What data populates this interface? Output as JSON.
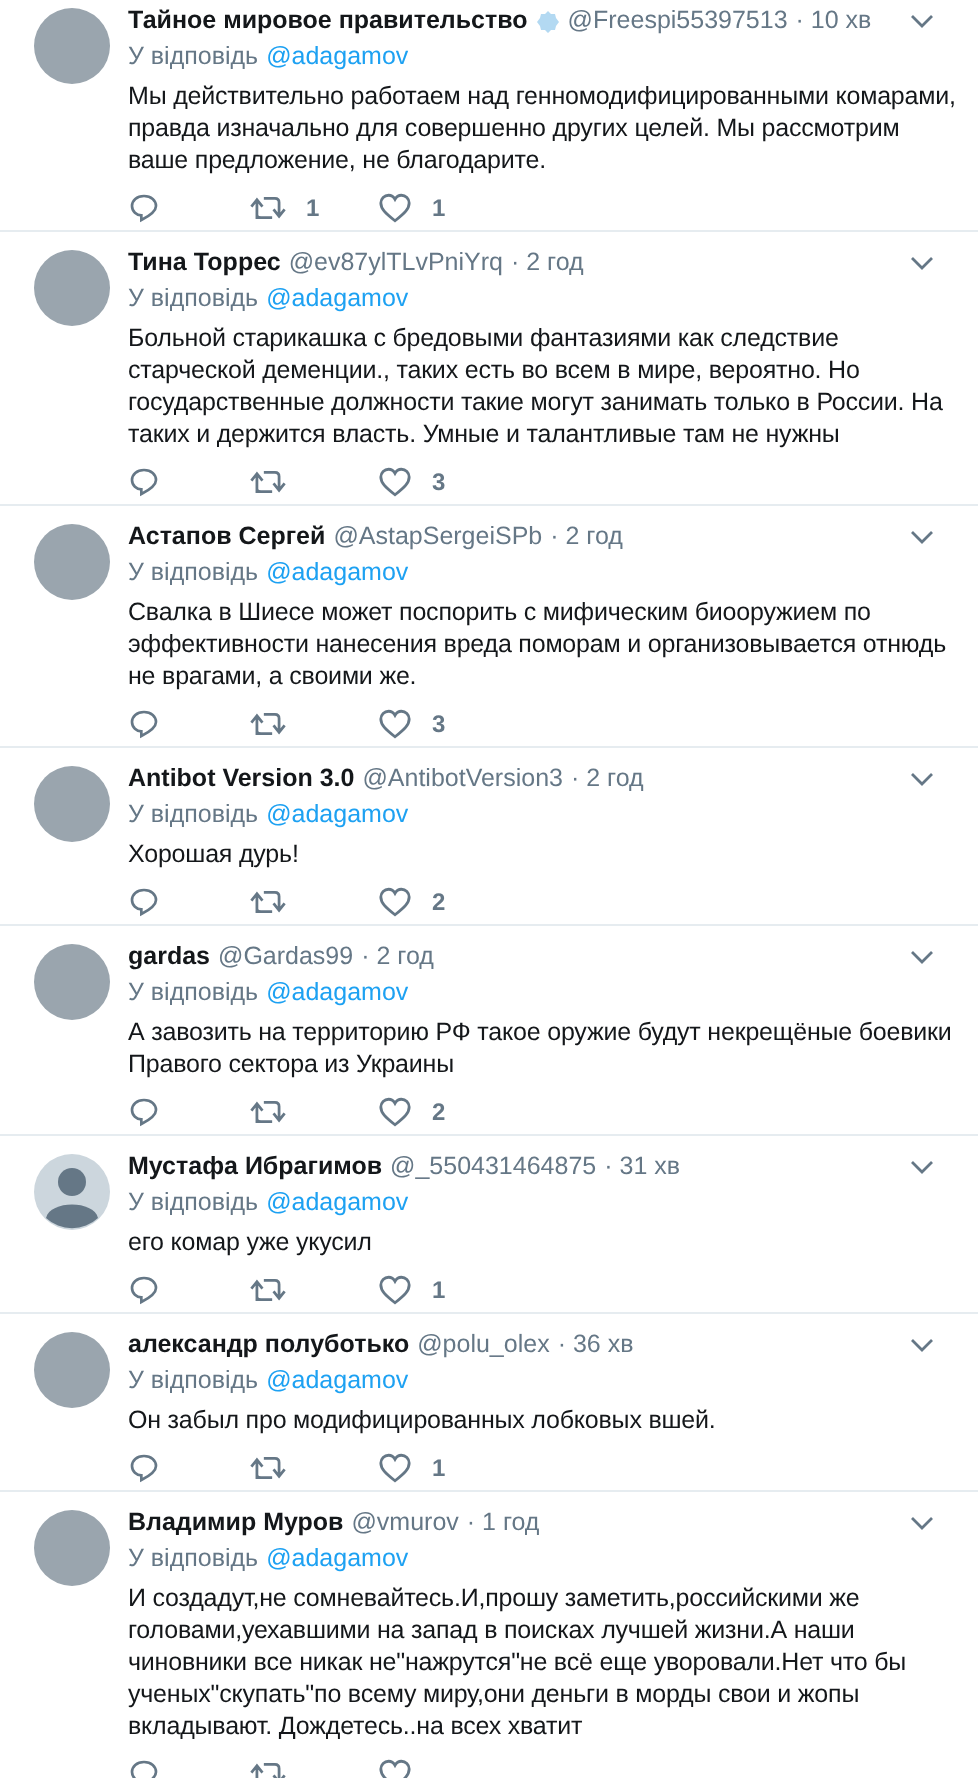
{
  "tweets": [
    {
      "name": "Тайное мировое правительство",
      "verified": true,
      "handle": "@Freespi55397513",
      "time": "· 10 хв",
      "default_avatar": false,
      "reply_prefix": "У відповідь",
      "reply_to": "@adagamov",
      "text": "Мы действительно работаем над генномодифицированными комарами, правда изначально для совершенно других целей. Мы рассмотрим ваше предложение, не благодарите.",
      "retweet_count": "1",
      "like_count": "1"
    },
    {
      "name": "Тина Торрес",
      "verified": false,
      "handle": "@ev87ylTLvPniYrq",
      "time": "· 2 год",
      "default_avatar": false,
      "reply_prefix": "У відповідь",
      "reply_to": "@adagamov",
      "text": "Больной старикашка с бредовыми фантазиями как следствие старческой деменции., таких есть во всем в мире, вероятно. Но государственные должности такие могут занимать только  в России. На таких и держится власть. Умные и талантливые там не нужны",
      "like_count": "3"
    },
    {
      "name": "Астапов Сергей",
      "verified": false,
      "handle": "@AstapSergeiSPb",
      "time": "· 2 год",
      "default_avatar": false,
      "reply_prefix": "У відповідь",
      "reply_to": "@adagamov",
      "text": "Свалка в Шиесе может поспорить с мифическим биооружием по эффективности нанесения вреда поморам и организовывается отнюдь не врагами, а своими же.",
      "like_count": "3"
    },
    {
      "name": "Antibot Version 3.0",
      "verified": false,
      "handle": "@AntibotVersion3",
      "time": "· 2 год",
      "default_avatar": false,
      "reply_prefix": "У відповідь",
      "reply_to": "@adagamov",
      "text": "Хорошая дурь!",
      "like_count": "2"
    },
    {
      "name": "gardas",
      "verified": false,
      "handle": "@Gardas99",
      "time": "· 2 год",
      "default_avatar": false,
      "reply_prefix": "У відповідь",
      "reply_to": "@adagamov",
      "text": "А завозить на территорию РФ такое оружие будут некрещёные боевики Правого сектора из Украины",
      "like_count": "2"
    },
    {
      "name": "Мустафа Ибрагимов",
      "verified": false,
      "handle": "@_550431464875",
      "time": "· 31 хв",
      "default_avatar": true,
      "reply_prefix": "У відповідь",
      "reply_to": "@adagamov",
      "text": "его комар уже укусил",
      "like_count": "1"
    },
    {
      "name": "александр полуботько",
      "verified": false,
      "handle": "@polu_olex",
      "time": "· 36 хв",
      "default_avatar": false,
      "reply_prefix": "У відповідь",
      "reply_to": "@adagamov",
      "text": "Он забыл про модифицированных лобковых вшей.",
      "like_count": "1"
    },
    {
      "name": "Владимир Муров",
      "verified": false,
      "handle": "@vmurov",
      "time": "· 1 год",
      "default_avatar": false,
      "reply_prefix": "У відповідь",
      "reply_to": "@adagamov",
      "text": "И создадут,не сомневайтесь.И,прошу заметить,российскими же головами,уехавшими на запад в поисках лучшей жизни.А наши чиновники все никак не\"нажрутся\"не всё еще уворовали.Нет что бы ученых\"скупать\"по всему миру,они деньги в морды свои и жопы вкладывают. Дождетесь..на всех хватит"
    }
  ]
}
